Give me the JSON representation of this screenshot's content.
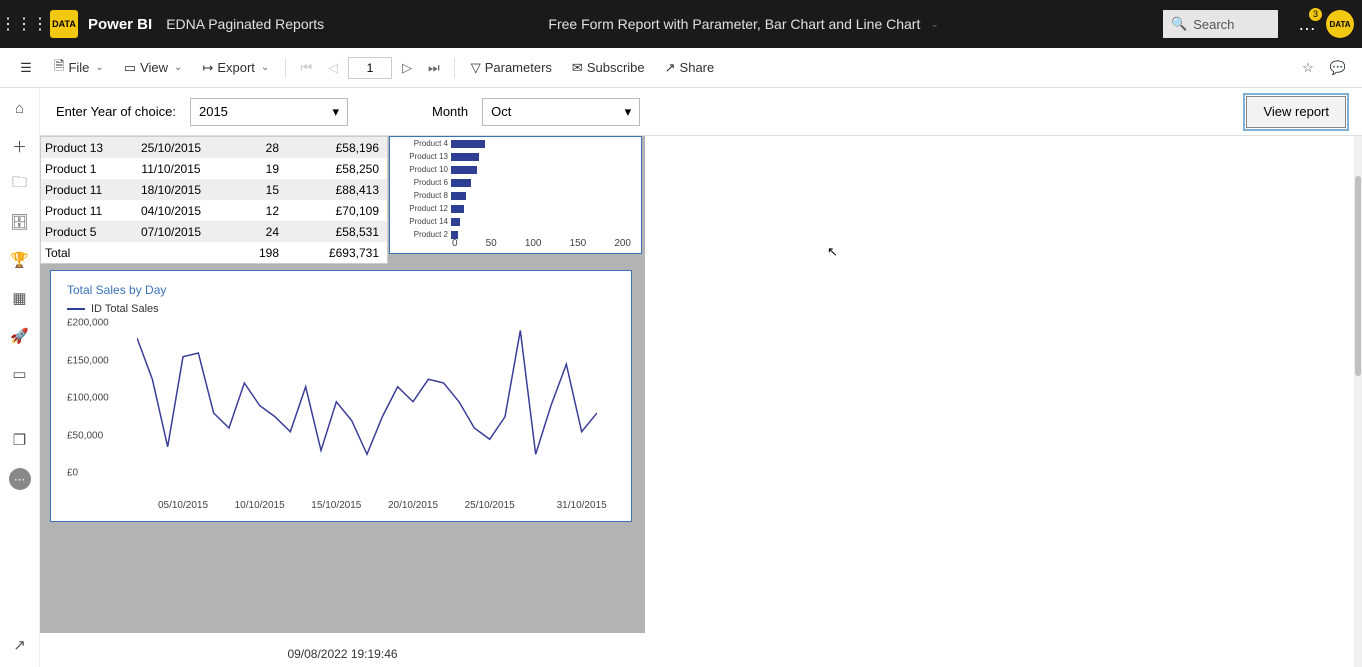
{
  "header": {
    "brand": "Power BI",
    "workspace": "EDNA Paginated Reports",
    "report_title": "Free Form Report with Parameter, Bar Chart and Line Chart",
    "search_placeholder": "Search",
    "notif_count": "3"
  },
  "toolbar": {
    "file": "File",
    "view": "View",
    "export": "Export",
    "page_current": "1",
    "parameters": "Parameters",
    "subscribe": "Subscribe",
    "share": "Share"
  },
  "params": {
    "year_label": "Enter Year of choice:",
    "year_value": "2015",
    "month_label": "Month",
    "month_value": "Oct",
    "view_report": "View report"
  },
  "table": {
    "rows": [
      {
        "product": "Product 13",
        "date": "25/10/2015",
        "qty": "28",
        "amount": "£58,196"
      },
      {
        "product": "Product 1",
        "date": "11/10/2015",
        "qty": "19",
        "amount": "£58,250"
      },
      {
        "product": "Product 11",
        "date": "18/10/2015",
        "qty": "15",
        "amount": "£88,413"
      },
      {
        "product": "Product 11",
        "date": "04/10/2015",
        "qty": "12",
        "amount": "£70,109"
      },
      {
        "product": "Product 5",
        "date": "07/10/2015",
        "qty": "24",
        "amount": "£58,531"
      }
    ],
    "total_label": "Total",
    "total_qty": "198",
    "total_amount": "£693,731"
  },
  "chart_data": [
    {
      "type": "bar",
      "orientation": "horizontal",
      "xlabel": "",
      "ylabel": "",
      "xlim": [
        0,
        200
      ],
      "x_ticks": [
        "0",
        "50",
        "100",
        "150",
        "200"
      ],
      "series": [
        {
          "name": "value",
          "values": [
            40,
            33,
            30,
            23,
            18,
            15,
            10,
            8
          ]
        }
      ],
      "categories": [
        "Product 4",
        "Product 13",
        "Product 10",
        "Product 6",
        "Product 8",
        "Product 12",
        "Product 14",
        "Product 2"
      ]
    },
    {
      "type": "line",
      "title": "Total Sales by Day",
      "legend": "ID Total Sales",
      "xlabel": "",
      "ylabel": "",
      "ylim": [
        0,
        200000
      ],
      "y_ticks": [
        "£200,000",
        "£150,000",
        "£100,000",
        "£50,000",
        "£0"
      ],
      "x_ticks": [
        "05/10/2015",
        "10/10/2015",
        "15/10/2015",
        "20/10/2015",
        "25/10/2015",
        "31/10/2015"
      ],
      "x": [
        1,
        2,
        3,
        4,
        5,
        6,
        7,
        8,
        9,
        10,
        11,
        12,
        13,
        14,
        15,
        16,
        17,
        18,
        19,
        20,
        21,
        22,
        23,
        24,
        25,
        26,
        27,
        28,
        29,
        30,
        31
      ],
      "series": [
        {
          "name": "ID Total Sales",
          "values": [
            180000,
            125000,
            35000,
            155000,
            160000,
            80000,
            60000,
            120000,
            90000,
            75000,
            55000,
            115000,
            30000,
            95000,
            70000,
            25000,
            75000,
            115000,
            95000,
            125000,
            120000,
            95000,
            60000,
            45000,
            75000,
            190000,
            25000,
            90000,
            145000,
            55000,
            80000
          ]
        }
      ]
    }
  ],
  "footer": {
    "timestamp": "09/08/2022 19:19:46"
  }
}
